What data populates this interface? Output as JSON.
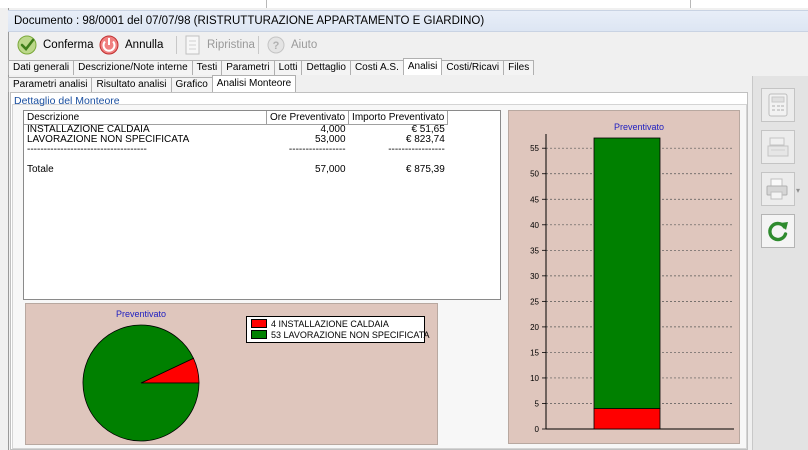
{
  "window": {
    "title": "Documento : 98/0001 del 07/07/98 (RISTRUTTURAZIONE APPARTAMENTO E GIARDINO)"
  },
  "toolbar": {
    "confirm_label": "Conferma",
    "cancel_label": "Annulla",
    "restore_label": "Ripristina",
    "help_label": "Aiuto"
  },
  "tabs": [
    {
      "label": "Dati generali"
    },
    {
      "label": "Descrizione/Note interne"
    },
    {
      "label": "Testi"
    },
    {
      "label": "Parametri"
    },
    {
      "label": "Lotti"
    },
    {
      "label": "Dettaglio"
    },
    {
      "label": "Costi A.S."
    },
    {
      "label": "Analisi",
      "active": true
    },
    {
      "label": "Costi/Ricavi"
    },
    {
      "label": "Files"
    }
  ],
  "subtabs": [
    {
      "label": "Parametri analisi"
    },
    {
      "label": "Risultato analisi"
    },
    {
      "label": "Grafico"
    },
    {
      "label": "Analisi Monteore",
      "active": true
    }
  ],
  "section": {
    "label": "Dettaglio del Monteore"
  },
  "grid": {
    "columns": [
      "Descrizione",
      "Ore Preventivato",
      "Importo Preventivato"
    ],
    "rows": [
      {
        "descrizione": "INSTALLAZIONE CALDAIA",
        "ore": "4,000",
        "importo": "€ 51,65"
      },
      {
        "descrizione": "LAVORAZIONE NON SPECIFICATA",
        "ore": "53,000",
        "importo": "€ 823,74"
      }
    ],
    "separator": {
      "descrizione": "------------------------------------",
      "ore": "-----------------",
      "importo": "-----------------"
    },
    "total": {
      "descrizione": "Totale",
      "ore": "57,000",
      "importo": "€ 875,39"
    }
  },
  "colors": {
    "series_red": "#ff0000",
    "series_green": "#008000",
    "chart_bg": "#dfc6bd",
    "chart_title": "#2020c0"
  },
  "chart_data": [
    {
      "type": "pie",
      "title": "Preventivato",
      "categories": [
        "INSTALLAZIONE CALDAIA",
        "LAVORAZIONE NON SPECIFICATA"
      ],
      "values": [
        4,
        53
      ],
      "legend": [
        "4 INSTALLAZIONE CALDAIA",
        "53 LAVORAZIONE NON SPECIFICATA"
      ],
      "legend_position": "right"
    },
    {
      "type": "bar",
      "stacked": true,
      "title": "Preventivato",
      "series": [
        {
          "name": "INSTALLAZIONE CALDAIA",
          "values": [
            4
          ]
        },
        {
          "name": "LAVORAZIONE NON SPECIFICATA",
          "values": [
            53
          ]
        }
      ],
      "ylim": [
        0,
        57
      ],
      "yticks": [
        0,
        5,
        10,
        15,
        20,
        25,
        30,
        35,
        40,
        45,
        50,
        55
      ],
      "grid": true
    }
  ],
  "side_tools": [
    {
      "icon": "calculator-icon",
      "enabled": false
    },
    {
      "icon": "cash-register-icon",
      "enabled": false
    },
    {
      "icon": "printer-icon",
      "enabled": false
    },
    {
      "icon": "refresh-icon",
      "enabled": true
    }
  ]
}
